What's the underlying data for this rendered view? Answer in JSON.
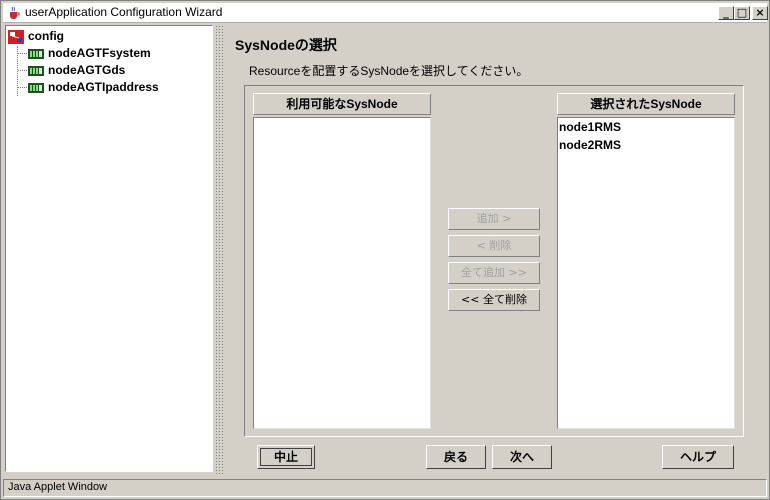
{
  "window": {
    "title": "userApplication Configuration Wizard",
    "controls": {
      "minimize": "_",
      "maximize": "□",
      "close": "×"
    }
  },
  "tree": {
    "root": {
      "label": "config",
      "icon": "config-icon"
    },
    "children": [
      {
        "label": "nodeAGTFsystem",
        "icon": "resource-icon"
      },
      {
        "label": "nodeAGTGds",
        "icon": "resource-icon"
      },
      {
        "label": "nodeAGTIpaddress",
        "icon": "resource-icon"
      }
    ]
  },
  "main": {
    "heading": "SysNodeの選択",
    "instruction": "Resourceを配置するSysNodeを選択してください。",
    "available": {
      "header": "利用可能なSysNode",
      "items": []
    },
    "selected": {
      "header": "選択されたSysNode",
      "items": [
        "node1RMS",
        "node2RMS"
      ]
    },
    "transfer_buttons": {
      "add": "追加 >",
      "remove": "< 削除",
      "add_all": "全て追加 >>",
      "remove_all": "<< 全て削除"
    }
  },
  "footer": {
    "cancel": "中止",
    "back": "戻る",
    "next": "次へ",
    "help": "ヘルプ"
  },
  "status": {
    "text": "Java Applet Window"
  }
}
